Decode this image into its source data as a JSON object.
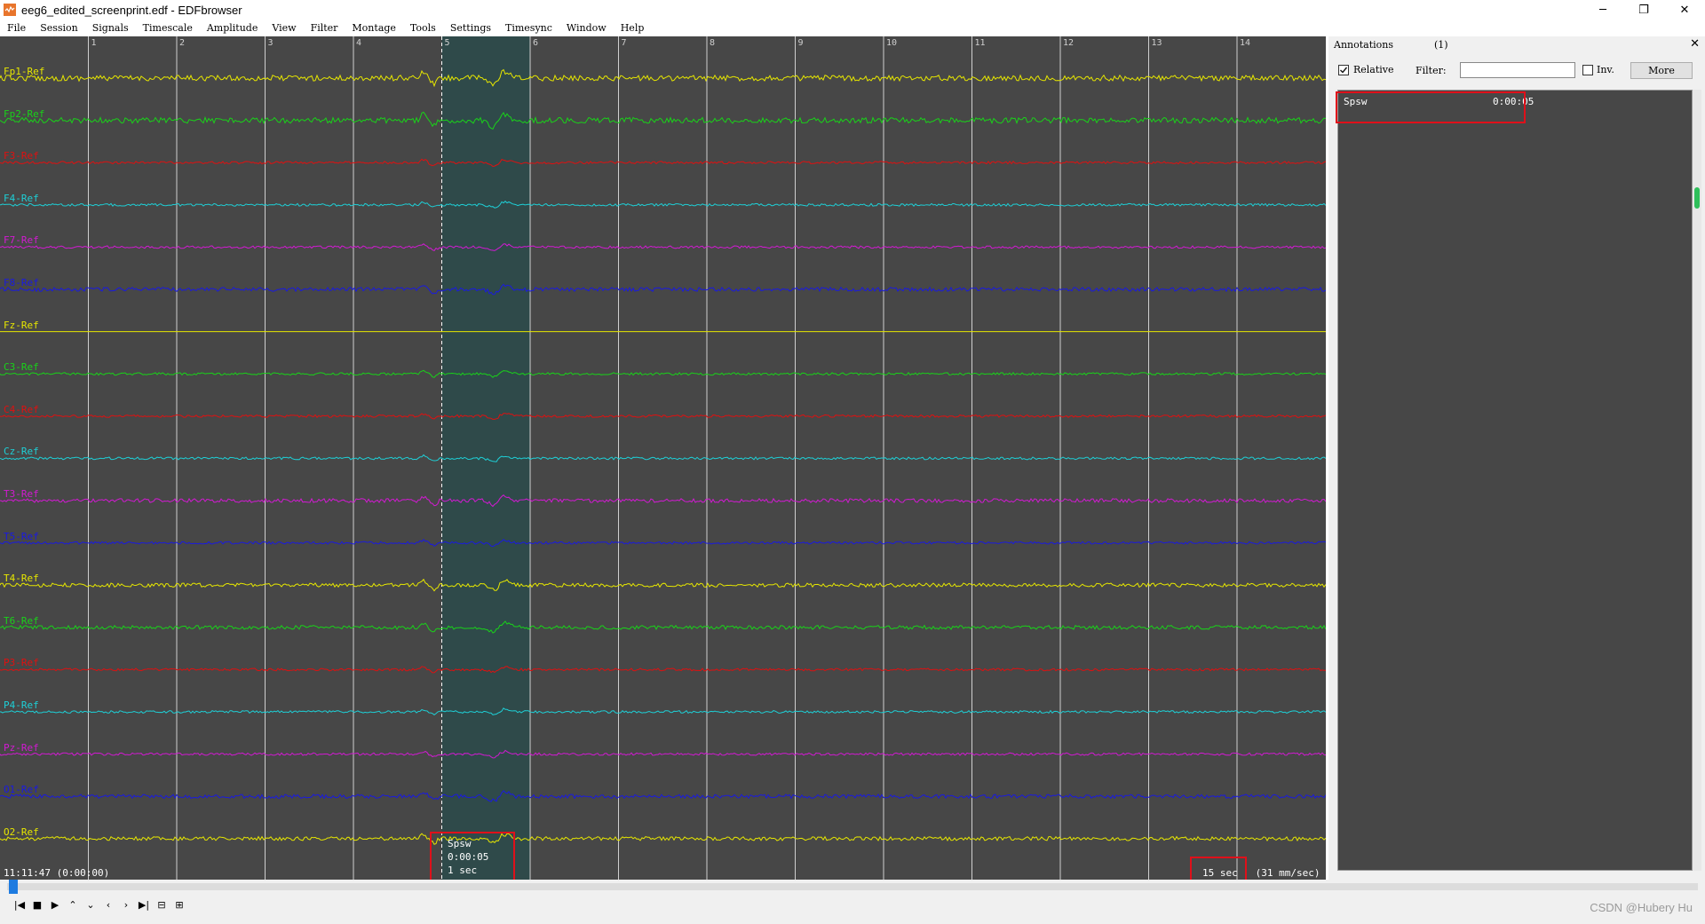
{
  "window": {
    "title": "eeg6_edited_screenprint.edf - EDFbrowser",
    "controls": [
      "─",
      "❐",
      "✕"
    ]
  },
  "menu": [
    "File",
    "Session",
    "Signals",
    "Timescale",
    "Amplitude",
    "View",
    "Filter",
    "Montage",
    "Tools",
    "Settings",
    "Timesync",
    "Window",
    "Help"
  ],
  "signals": {
    "channels": [
      {
        "label": "Fp1-Ref",
        "color": "#e6e600"
      },
      {
        "label": "Fp2-Ref",
        "color": "#19d219"
      },
      {
        "label": "F3-Ref",
        "color": "#e01010"
      },
      {
        "label": "F4-Ref",
        "color": "#1ecfd6"
      },
      {
        "label": "F7-Ref",
        "color": "#d21ad2"
      },
      {
        "label": "F8-Ref",
        "color": "#1a1ae0"
      },
      {
        "label": "Fz-Ref",
        "color": "#e6e600"
      },
      {
        "label": "C3-Ref",
        "color": "#19d219"
      },
      {
        "label": "C4-Ref",
        "color": "#e01010"
      },
      {
        "label": "Cz-Ref",
        "color": "#1ecfd6"
      },
      {
        "label": "T3-Ref",
        "color": "#d21ad2"
      },
      {
        "label": "T5-Ref",
        "color": "#1a1ae0"
      },
      {
        "label": "T4-Ref",
        "color": "#e6e600"
      },
      {
        "label": "T6-Ref",
        "color": "#19d219"
      },
      {
        "label": "P3-Ref",
        "color": "#e01010"
      },
      {
        "label": "P4-Ref",
        "color": "#1ecfd6"
      },
      {
        "label": "Pz-Ref",
        "color": "#d21ad2"
      },
      {
        "label": "O1-Ref",
        "color": "#1a1ae0"
      },
      {
        "label": "O2-Ref",
        "color": "#e6e600"
      }
    ],
    "seconds_marks": [
      "1",
      "2",
      "3",
      "4",
      "5",
      "6",
      "7",
      "8",
      "9",
      "10",
      "11",
      "12",
      "13",
      "14"
    ],
    "annotation": {
      "name": "Spsw",
      "onset": "0:00:05",
      "duration": "1 sec"
    },
    "start_time": "11:11:47 (0:00:00)",
    "timescale": "15 sec",
    "speed": "(31 mm/sec)",
    "background": "#474747",
    "highlight_color": "#2f4a4a"
  },
  "annotations_panel": {
    "title": "Annotations",
    "count": "(1)",
    "relative_label": "Relative",
    "relative_checked": true,
    "filter_label": "Filter:",
    "filter_value": "",
    "inv_label": "Inv.",
    "more_label": "More",
    "items": [
      {
        "name": "Spsw",
        "time": "0:00:05"
      }
    ]
  },
  "watermark": "CSDN @Hubery Hu"
}
